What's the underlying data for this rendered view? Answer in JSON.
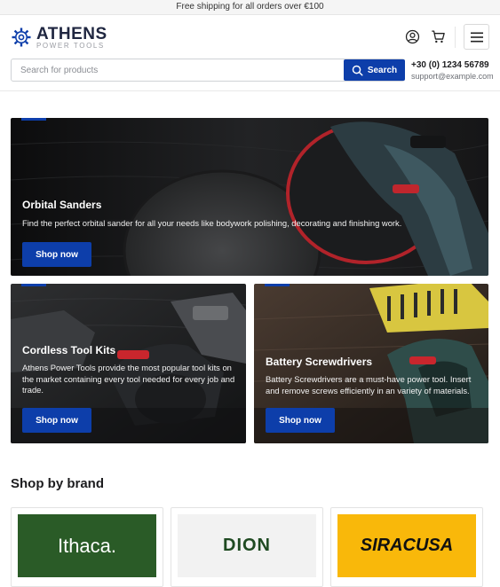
{
  "announcement": "Free shipping for all orders over €100",
  "logo": {
    "name": "ATHENS",
    "subtitle": "POWER TOOLS"
  },
  "header": {
    "account_icon": "user-circle-icon",
    "cart_icon": "cart-icon",
    "menu_icon": "hamburger-menu-icon"
  },
  "search": {
    "placeholder": "Search for products",
    "value": "",
    "button_label": "Search",
    "button_icon": "search-icon"
  },
  "contact": {
    "phone": "+30 (0) 1234 56789",
    "email": "support@example.com"
  },
  "banners": [
    {
      "title": "Orbital Sanders",
      "description": "Find the perfect orbital sander for all your needs like bodywork polishing, decorating and finishing work.",
      "cta": "Shop now"
    },
    {
      "title": "Cordless Tool Kits",
      "description": "Athens Power Tools provide the most popular tool kits on the market containing every tool needed for every job and trade.",
      "cta": "Shop now"
    },
    {
      "title": "Battery Screwdrivers",
      "description": "Battery Screwdrivers are a must-have power tool. Insert and remove screws efficiently in an variety of materials.",
      "cta": "Shop now"
    }
  ],
  "brands_section": {
    "title": "Shop by brand",
    "brands": [
      {
        "name": "Ithaca.",
        "color": "#2a5b27"
      },
      {
        "name": "DION",
        "color": "#f2f2f2"
      },
      {
        "name": "SIRACUSA",
        "color": "#f9b80a"
      }
    ]
  },
  "colors": {
    "accent": "#0d3eaa",
    "dark_text": "#1f2640"
  }
}
